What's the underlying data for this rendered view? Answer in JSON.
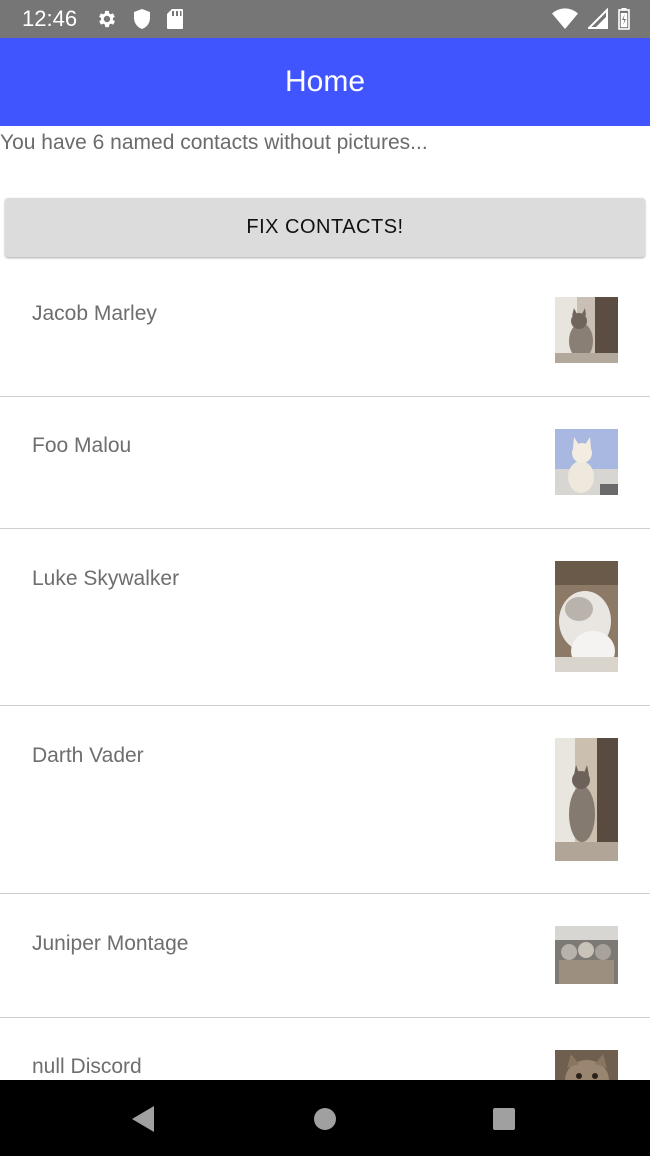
{
  "status_bar": {
    "time": "12:46",
    "left_icons": [
      "gear-icon",
      "shield-icon",
      "sd-card-icon"
    ],
    "right_icons": [
      "wifi-icon",
      "cell-signal-icon",
      "battery-icon"
    ]
  },
  "app_bar": {
    "title": "Home",
    "color": "#4155ff"
  },
  "summary": {
    "text": "You have 6 named contacts without pictures..."
  },
  "fix_button": {
    "label": "FIX CONTACTS!"
  },
  "contacts": [
    {
      "name": "Jacob Marley",
      "photo": "cat-photo"
    },
    {
      "name": "Foo Malou",
      "photo": "cat-photo"
    },
    {
      "name": "Luke Skywalker",
      "photo": "cat-photo"
    },
    {
      "name": "Darth Vader",
      "photo": "cat-photo"
    },
    {
      "name": "Juniper Montage",
      "photo": "cat-photo"
    },
    {
      "name": "null Discord",
      "photo": "cat-photo"
    }
  ],
  "nav_bar": {
    "buttons": [
      "back-icon",
      "home-icon",
      "recents-icon"
    ]
  }
}
